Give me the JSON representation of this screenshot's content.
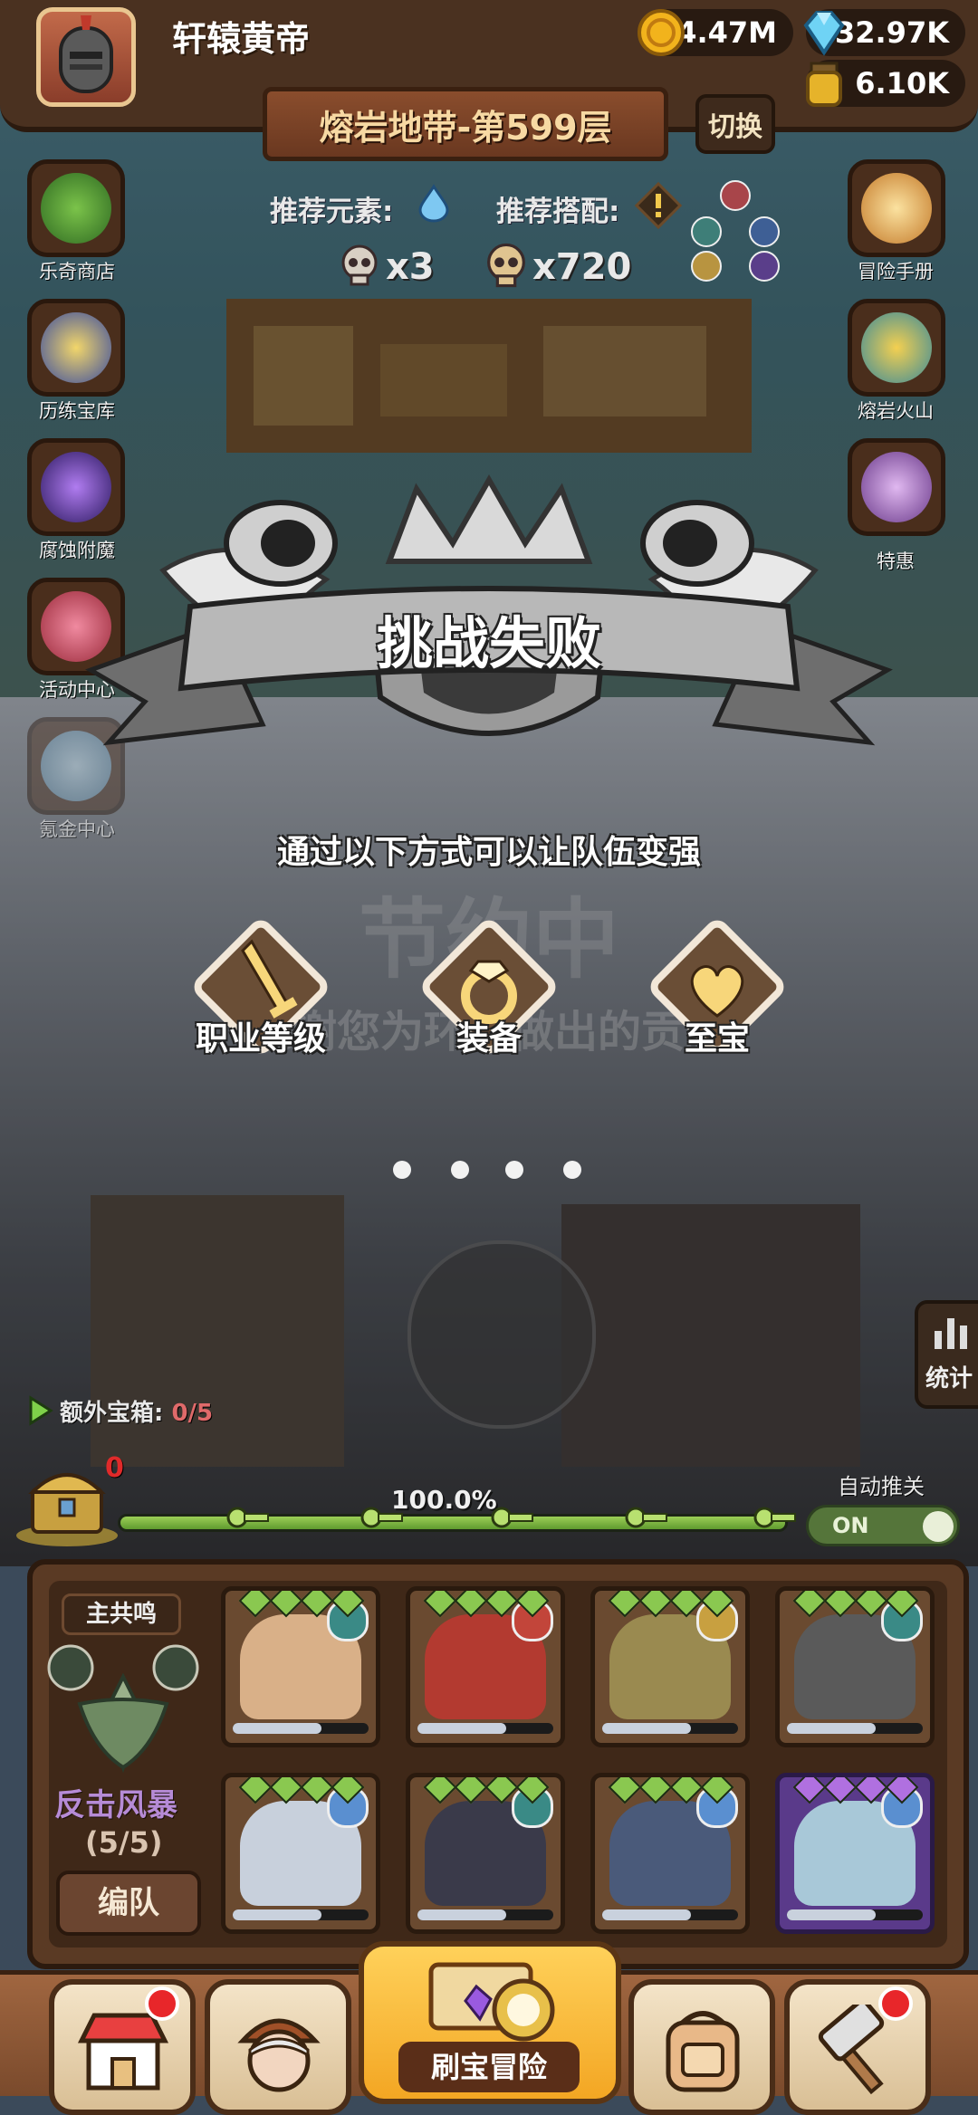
{
  "player": {
    "name": "轩辕黄帝"
  },
  "resources": [
    {
      "name": "gold",
      "value": "4.47M",
      "color": "#f2b31c"
    },
    {
      "name": "diamond",
      "value": "32.97K",
      "color": "#5fc9ef"
    },
    {
      "name": "potion",
      "value": "6.10K",
      "color": "#e6b32a"
    }
  ],
  "stage": {
    "title": "熔岩地带-第599层",
    "switch_label": "切换"
  },
  "recommend": {
    "element_label": "推荐元素:",
    "combo_label": "推荐搭配:"
  },
  "enemies": {
    "small_count": "x3",
    "big_count": "x720"
  },
  "left_menu": [
    {
      "label": "乐奇商店"
    },
    {
      "label": "历练宝库"
    },
    {
      "label": "腐蚀附魔"
    },
    {
      "label": "活动中心"
    },
    {
      "label": "氪金中心"
    }
  ],
  "right_menu": [
    {
      "label": "冒险手册"
    },
    {
      "label": "熔岩火山"
    },
    {
      "label": "特惠"
    }
  ],
  "dialog": {
    "title": "挑战失败",
    "subtitle": "通过以下方式可以让队伍变强",
    "options": [
      {
        "label": "职业等级",
        "icon": "sword-icon"
      },
      {
        "label": "装备",
        "icon": "ring-icon"
      },
      {
        "label": "至宝",
        "icon": "heart-icon"
      }
    ]
  },
  "background_text": {
    "festival": "节约中",
    "thanks": "感谢您为环保做出的贡献"
  },
  "battle": {
    "stats_label": "统计",
    "extra_chest_label": "额外宝箱:",
    "extra_chest_value": "0/5",
    "chest_count": "0",
    "progress_text": "100.0%",
    "progress": 1.0,
    "auto_push_label": "自动推关",
    "auto_push_state": "ON"
  },
  "team": {
    "resonance_tag": "主共鸣",
    "resonance_name": "反击风暴",
    "resonance_count": "(5/5)",
    "formation_label": "编队",
    "heroes": [
      {
        "name": "hero-crowned-warrior",
        "element": "wind",
        "rarity": "rare"
      },
      {
        "name": "hero-red-demon",
        "element": "fire",
        "rarity": "rare"
      },
      {
        "name": "hero-golden-knight",
        "element": "light",
        "rarity": "rare"
      },
      {
        "name": "hero-dark-knight",
        "element": "wind",
        "rarity": "rare"
      },
      {
        "name": "hero-white-hair",
        "element": "water",
        "rarity": "rare"
      },
      {
        "name": "hero-pirate",
        "element": "wind",
        "rarity": "rare"
      },
      {
        "name": "hero-ninja",
        "element": "water",
        "rarity": "rare"
      },
      {
        "name": "hero-ice-king",
        "element": "water",
        "rarity": "epic"
      }
    ]
  },
  "bottom_nav": {
    "main_label": "刷宝冒险"
  }
}
